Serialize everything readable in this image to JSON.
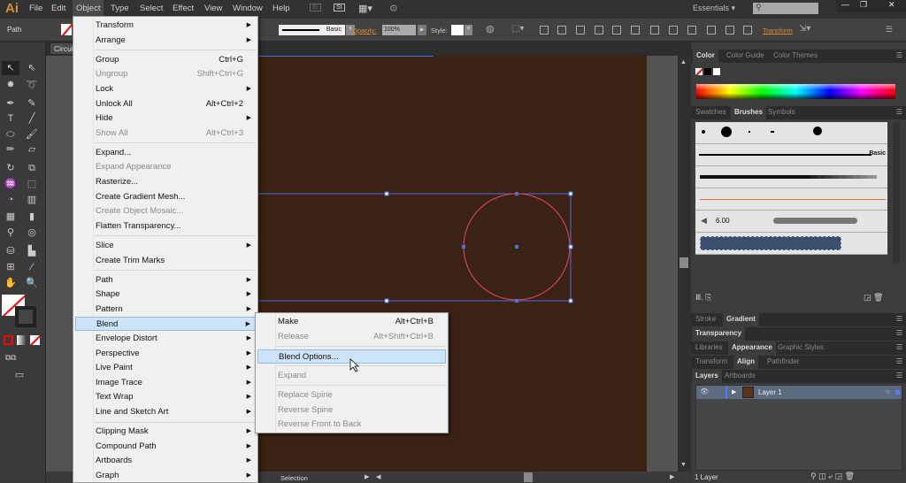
{
  "app": {
    "logo": "Ai",
    "menus": [
      "File",
      "Edit",
      "Object",
      "Type",
      "Select",
      "Effect",
      "View",
      "Window",
      "Help"
    ],
    "active_menu": "Object",
    "bridge": "Br",
    "stock": "St",
    "workspace": "Essentials",
    "search_placeholder": ""
  },
  "control": {
    "selection_type": "Path",
    "stroke_profile": "Basic",
    "opacity_label": "Opacity:",
    "opacity_value": "100%",
    "style_label": "Style:",
    "transform_link": "Transform"
  },
  "document": {
    "tab": "Circul"
  },
  "status": {
    "tool": "Selection"
  },
  "object_menu": [
    {
      "label": "Transform",
      "submenu": true
    },
    {
      "label": "Arrange",
      "submenu": true
    },
    {
      "sep": true
    },
    {
      "label": "Group",
      "shortcut": "Ctrl+G"
    },
    {
      "label": "Ungroup",
      "shortcut": "Shift+Ctrl+G",
      "disabled": true
    },
    {
      "label": "Lock",
      "submenu": true
    },
    {
      "label": "Unlock All",
      "shortcut": "Alt+Ctrl+2"
    },
    {
      "label": "Hide",
      "submenu": true
    },
    {
      "label": "Show All",
      "shortcut": "Alt+Ctrl+3",
      "disabled": true
    },
    {
      "sep": true
    },
    {
      "label": "Expand..."
    },
    {
      "label": "Expand Appearance",
      "disabled": true
    },
    {
      "label": "Rasterize..."
    },
    {
      "label": "Create Gradient Mesh..."
    },
    {
      "label": "Create Object Mosaic...",
      "disabled": true
    },
    {
      "label": "Flatten Transparency..."
    },
    {
      "sep": true
    },
    {
      "label": "Slice",
      "submenu": true
    },
    {
      "label": "Create Trim Marks"
    },
    {
      "sep": true
    },
    {
      "label": "Path",
      "submenu": true
    },
    {
      "label": "Shape",
      "submenu": true
    },
    {
      "label": "Pattern",
      "submenu": true
    },
    {
      "label": "Blend",
      "submenu": true,
      "highlighted": true
    },
    {
      "label": "Envelope Distort",
      "submenu": true
    },
    {
      "label": "Perspective",
      "submenu": true
    },
    {
      "label": "Live Paint",
      "submenu": true
    },
    {
      "label": "Image Trace",
      "submenu": true
    },
    {
      "label": "Text Wrap",
      "submenu": true
    },
    {
      "label": "Line and Sketch Art",
      "submenu": true
    },
    {
      "sep": true
    },
    {
      "label": "Clipping Mask",
      "submenu": true
    },
    {
      "label": "Compound Path",
      "submenu": true
    },
    {
      "label": "Artboards",
      "submenu": true
    },
    {
      "label": "Graph",
      "submenu": true
    }
  ],
  "blend_menu": [
    {
      "label": "Make",
      "shortcut": "Alt+Ctrl+B"
    },
    {
      "label": "Release",
      "shortcut": "Alt+Shift+Ctrl+B",
      "disabled": true
    },
    {
      "sep": true
    },
    {
      "label": "Blend Options...",
      "highlighted": true
    },
    {
      "sep": true
    },
    {
      "label": "Expand",
      "disabled": true
    },
    {
      "sep": true
    },
    {
      "label": "Replace Spine",
      "disabled": true
    },
    {
      "label": "Reverse Spine",
      "disabled": true
    },
    {
      "label": "Reverse Front to Back",
      "disabled": true
    }
  ],
  "panels": {
    "color_tabs": [
      "Color",
      "Color Guide",
      "Color Themes"
    ],
    "brush_tabs": [
      "Swatches",
      "Brushes",
      "Symbols"
    ],
    "brush_basic": "Basic",
    "brush_size": "6.00",
    "stroke_tabs": [
      "Stroke",
      "Gradient"
    ],
    "transparency_tabs": [
      "Transparency"
    ],
    "appearance_tabs": [
      "Libraries",
      "Appearance",
      "Graphic Styles"
    ],
    "align_tabs": [
      "Transform",
      "Align",
      "Pathfinder"
    ],
    "layers_tabs": [
      "Layers",
      "Artboards"
    ],
    "layer_name": "Layer 1",
    "layer_count": "1 Layer"
  },
  "colors": {
    "artboard": "#3b2314",
    "selection": "#4a6fe0",
    "path_stroke": "#d0405a",
    "accent_orange": "#e08a2e"
  }
}
